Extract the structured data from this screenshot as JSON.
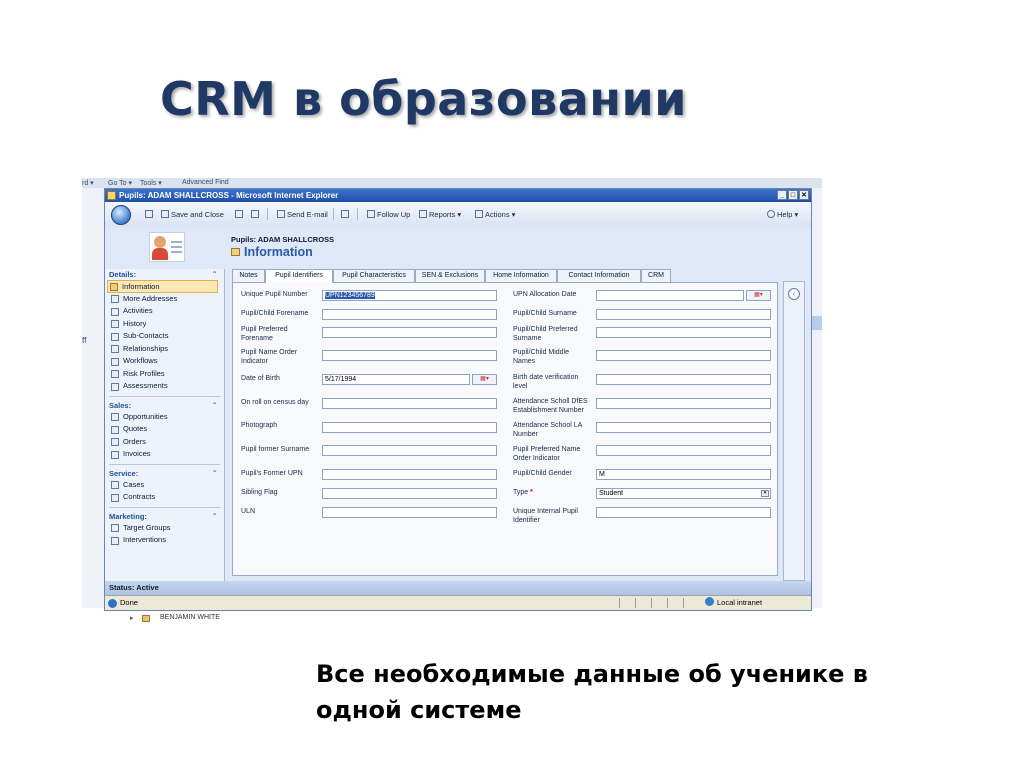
{
  "slide": {
    "title": "CRM в образовании",
    "caption_line1": "Все необходимые данные об ученике в",
    "caption_line2": "одной системе"
  },
  "background": {
    "frag1": "rd ▾",
    "frag2": "Go To ▾",
    "frag3": "Tools ▾",
    "frag4": "Advanced Find",
    "left_fragment": "ff",
    "bottom_row": "BENJAMIN WHITE"
  },
  "window": {
    "title": "Pupils: ADAM SHALLCROSS - Microsoft Internet Explorer",
    "minimize": "_",
    "maximize": "□",
    "close": "✕"
  },
  "toolbar": {
    "save_close": "Save and Close",
    "send_email": "Send E-mail",
    "follow_up": "Follow Up",
    "reports": "Reports ▾",
    "actions": "Actions ▾",
    "help": "Help ▾"
  },
  "record": {
    "entity_label": "Pupils: ADAM SHALLCROSS",
    "form_title": "Information"
  },
  "nav": {
    "details_header": "Details:",
    "details_items": [
      "Information",
      "More Addresses",
      "Activities",
      "History",
      "Sub-Contacts",
      "Relationships",
      "Workflows",
      "Risk Profiles",
      "Assessments"
    ],
    "sales_header": "Sales:",
    "sales_items": [
      "Opportunities",
      "Quotes",
      "Orders",
      "Invoices"
    ],
    "service_header": "Service:",
    "service_items": [
      "Cases",
      "Contracts"
    ],
    "marketing_header": "Marketing:",
    "marketing_items": [
      "Target Groups",
      "Interventions"
    ],
    "collapse_glyph": "⌃"
  },
  "tabs": [
    "Notes",
    "Pupil Identifiers",
    "Pupil Characteristics",
    "SEN & Exclusions",
    "Home Information",
    "Contact Information",
    "CRM"
  ],
  "form": {
    "left": [
      {
        "label": "Unique Pupil Number",
        "value": "UPN123456789"
      },
      {
        "label": "Pupil/Child Forename",
        "value": ""
      },
      {
        "label": "Pupil Preferred Forename",
        "value": ""
      },
      {
        "label": "Pupil Name Order Indicator",
        "value": ""
      },
      {
        "label": "Date of Birth",
        "value": "5/17/1994"
      },
      {
        "label": "On roll on census day",
        "value": ""
      },
      {
        "label": "Photograph",
        "value": ""
      },
      {
        "label": "Pupil former Surname",
        "value": ""
      },
      {
        "label": "Pupil's Former UPN",
        "value": ""
      },
      {
        "label": "Sibling Flag",
        "value": ""
      },
      {
        "label": "ULN",
        "value": ""
      }
    ],
    "right": [
      {
        "label": "UPN Allocation Date",
        "value": ""
      },
      {
        "label": "Pupil/Child Surname",
        "value": ""
      },
      {
        "label": "Pupil/Child Preferred Surname",
        "value": ""
      },
      {
        "label": "Pupil/Child Middle Names",
        "value": ""
      },
      {
        "label": "Birth date verification level",
        "value": ""
      },
      {
        "label": "Attendance Scholl DfES Establishment Number",
        "value": ""
      },
      {
        "label": "Attendance School LA Number",
        "value": ""
      },
      {
        "label": "Pupil Preferred Name Order Indicator",
        "value": ""
      },
      {
        "label": "Pupil/Child Gender",
        "value": "M"
      },
      {
        "label": "Type",
        "value": "Student",
        "required": "*"
      },
      {
        "label": "Unique Internal Pupil Identifier",
        "value": ""
      }
    ]
  },
  "status": {
    "record_status": "Status: Active",
    "ie_done": "Done",
    "zone": "Local intranet"
  }
}
